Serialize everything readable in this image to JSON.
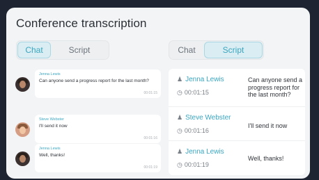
{
  "title": "Conference transcription",
  "left_toggle": {
    "chat": "Chat",
    "script": "Script",
    "active": "Chat"
  },
  "right_toggle": {
    "chat": "Chat",
    "script": "Script",
    "active": "Script"
  },
  "chat_messages": [
    {
      "name": "Jenna Lewis",
      "text": "Can anyone send a progress report for the last month?",
      "time": "00:01:15"
    },
    {
      "name": "Steve Webster",
      "text": "I'll send it now",
      "time": "00:01:16"
    },
    {
      "name": "Jenna Lewis",
      "text": "Well, thanks!",
      "time": "00:01:19"
    }
  ],
  "script_entries": [
    {
      "name": "Jenna Lewis",
      "time": "00:01:15",
      "text": "Can anyone send a progress report for the last month?"
    },
    {
      "name": "Steve Webster",
      "time": "00:01:16",
      "text": "I'll send it now"
    },
    {
      "name": "Jenna Lewis",
      "time": "00:01:19",
      "text": "Well, thanks!"
    }
  ],
  "icons": {
    "user": "user-icon",
    "clock": "clock-icon"
  },
  "colors": {
    "accent": "#3aa6c0",
    "background": "#1f2433",
    "card": "#f3f4f5"
  }
}
